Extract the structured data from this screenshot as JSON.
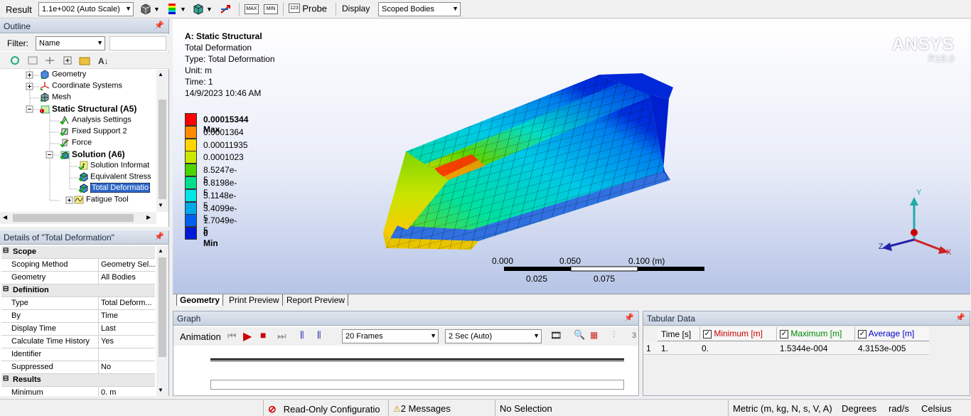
{
  "toolbar": {
    "result_label": "Result",
    "scale_value": "1.1e+002 (Auto Scale)",
    "probe_label": "Probe",
    "display_label": "Display",
    "display_value": "Scoped Bodies",
    "max_label": "MAX",
    "min_label": "MIN"
  },
  "outline": {
    "title": "Outline",
    "filter_label": "Filter:",
    "filter_value": "Name",
    "items": [
      {
        "label": "Geometry"
      },
      {
        "label": "Coordinate Systems"
      },
      {
        "label": "Mesh"
      },
      {
        "label": "Static Structural (A5)"
      },
      {
        "label": "Analysis Settings"
      },
      {
        "label": "Fixed Support 2"
      },
      {
        "label": "Force"
      },
      {
        "label": "Solution (A6)"
      },
      {
        "label": "Solution Informat"
      },
      {
        "label": "Equivalent Stress"
      },
      {
        "label": "Total Deformatio"
      },
      {
        "label": "Fatigue Tool"
      }
    ]
  },
  "details": {
    "title": "Details of \"Total Deformation\"",
    "rows": [
      {
        "name": "Scope",
        "value": ""
      },
      {
        "name": "Scoping Method",
        "value": "Geometry Sel..."
      },
      {
        "name": "Geometry",
        "value": "All Bodies"
      },
      {
        "name": "Definition",
        "value": ""
      },
      {
        "name": "Type",
        "value": "Total Deform..."
      },
      {
        "name": "By",
        "value": "Time"
      },
      {
        "name": "Display Time",
        "value": "Last"
      },
      {
        "name": "Calculate Time History",
        "value": "Yes"
      },
      {
        "name": "Identifier",
        "value": ""
      },
      {
        "name": "Suppressed",
        "value": "No"
      },
      {
        "name": "Results",
        "value": ""
      },
      {
        "name": "Minimum",
        "value": "0. m"
      }
    ]
  },
  "viewport": {
    "header": {
      "title": "A: Static Structural",
      "line1": "Total Deformation",
      "line2": "Type: Total Deformation",
      "line3": "Unit: m",
      "line4": "Time: 1",
      "line5": "14/9/2023 10:46 AM"
    },
    "brand": "ANSYS",
    "version": "R19.0",
    "legend": [
      {
        "label": "0.00015344 Max",
        "color": "#ff0000"
      },
      {
        "label": "0.0001364",
        "color": "#ff8c00"
      },
      {
        "label": "0.00011935",
        "color": "#ffd500"
      },
      {
        "label": "0.0001023",
        "color": "#c8e800"
      },
      {
        "label": "8.5247e-5",
        "color": "#4cd400"
      },
      {
        "label": "6.8198e-5",
        "color": "#00e08a"
      },
      {
        "label": "5.1148e-5",
        "color": "#00e6e6"
      },
      {
        "label": "3.4099e-5",
        "color": "#00a8e8"
      },
      {
        "label": "1.7049e-5",
        "color": "#0060ee"
      },
      {
        "label": "0 Min",
        "color": "#0018d8"
      }
    ],
    "scale_top": [
      "0.000",
      "0.050",
      "0.100 (m)"
    ],
    "scale_bottom": [
      "0.025",
      "0.075"
    ],
    "axes": {
      "x": "X",
      "y": "Y",
      "z": "Z"
    },
    "tabs": [
      "Geometry",
      "Print Preview",
      "Report Preview"
    ]
  },
  "graph": {
    "title": "Graph",
    "animation_label": "Animation",
    "frames_value": "20 Frames",
    "duration_value": "2 Sec (Auto)",
    "tool_number": "3"
  },
  "tabular": {
    "title": "Tabular Data",
    "columns": [
      "Time [s]",
      "Minimum [m]",
      "Maximum [m]",
      "Average [m]"
    ],
    "rows": [
      {
        "index": "1",
        "time": "1.",
        "min": "0.",
        "max": "1.5344e-004",
        "avg": "4.3153e-005"
      }
    ]
  },
  "status": {
    "readonly": "Read-Only Configuratio",
    "messages": "2 Messages",
    "selection": "No Selection",
    "units": "Metric (m, kg, N, s, V, A)",
    "angle": "Degrees",
    "rate": "rad/s",
    "temp": "Celsius"
  }
}
